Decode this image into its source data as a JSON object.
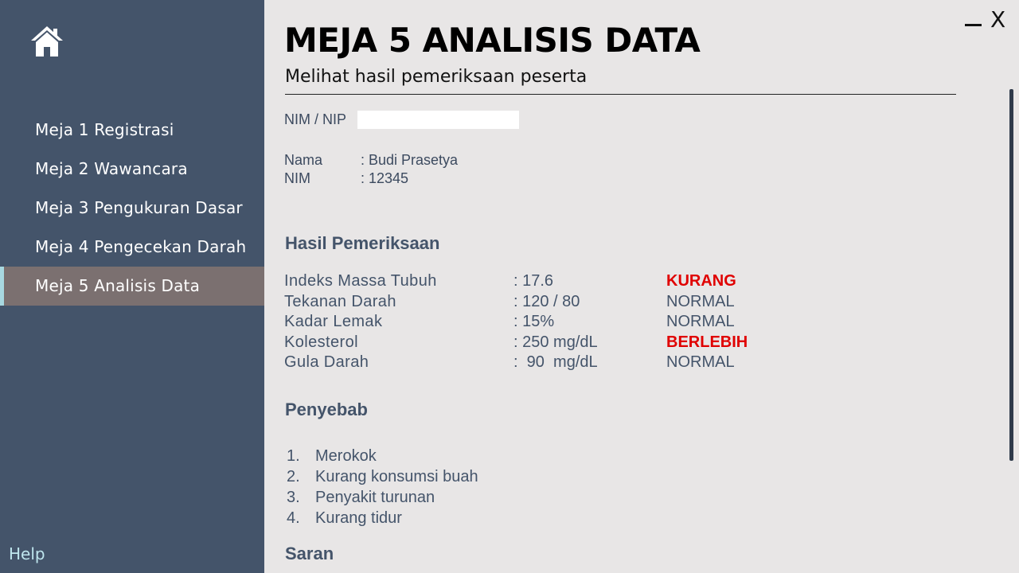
{
  "sidebar": {
    "home_icon": "home-icon",
    "items": [
      {
        "label": "Meja 1 Registrasi"
      },
      {
        "label": "Meja 2 Wawancara"
      },
      {
        "label": "Meja 3 Pengukuran Dasar"
      },
      {
        "label": "Meja 4 Pengecekan Darah"
      },
      {
        "label": "Meja 5 Analisis Data",
        "active": true
      }
    ],
    "help_label": "Help"
  },
  "window": {
    "minimize_icon": "minimize-icon",
    "close_glyph": "X"
  },
  "header": {
    "title": "MEJA 5 ANALISIS DATA",
    "subtitle": "Melihat hasil pemeriksaan peserta"
  },
  "search": {
    "label": "NIM / NIP",
    "value": "",
    "placeholder": ""
  },
  "participant": {
    "name_key": "Nama",
    "name_value": ": Budi Prasetya",
    "nim_key": "NIM",
    "nim_value": ": 12345"
  },
  "results": {
    "title": "Hasil Pemeriksaan",
    "rows": [
      {
        "name": "Indeks Massa Tubuh",
        "value": ": 17.6",
        "status": "KURANG",
        "alert": true
      },
      {
        "name": "Tekanan Darah",
        "value": ": 120 / 80",
        "status": "NORMAL",
        "alert": false
      },
      {
        "name": "Kadar Lemak",
        "value": ": 15%",
        "status": "NORMAL",
        "alert": false
      },
      {
        "name": "Kolesterol",
        "value": ": 250 mg/dL",
        "status": "BERLEBIH",
        "alert": true
      },
      {
        "name": "Gula Darah",
        "value": ":  90  mg/dL",
        "status": "NORMAL",
        "alert": false
      }
    ]
  },
  "causes": {
    "title": "Penyebab",
    "items": [
      {
        "num": "1.",
        "text": "Merokok"
      },
      {
        "num": "2.",
        "text": "Kurang konsumsi buah"
      },
      {
        "num": "3.",
        "text": "Penyakit turunan"
      },
      {
        "num": "4.",
        "text": "Kurang tidur"
      }
    ]
  },
  "advice": {
    "title": "Saran"
  },
  "colors": {
    "sidebar_bg": "#44546a",
    "active_bg": "#7b7070",
    "alert": "#e00000",
    "text": "#44546a"
  }
}
